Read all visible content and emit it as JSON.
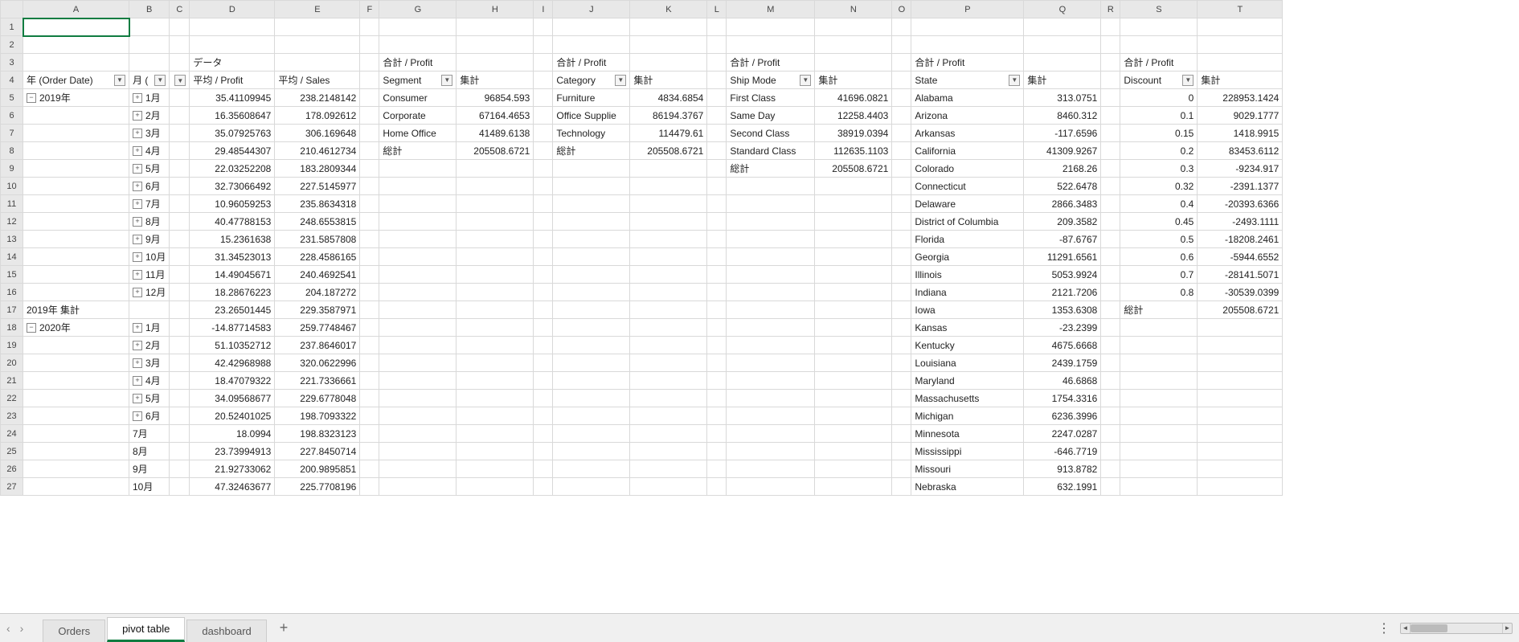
{
  "columns": [
    "A",
    "B",
    "C",
    "D",
    "E",
    "F",
    "G",
    "H",
    "I",
    "J",
    "K",
    "L",
    "M",
    "N",
    "O",
    "P",
    "Q",
    "R",
    "S",
    "T"
  ],
  "col_widths": {
    "A": 132,
    "B": 42,
    "C": 24,
    "D": 106,
    "E": 106,
    "F": 24,
    "G": 96,
    "H": 96,
    "I": 24,
    "J": 96,
    "K": 96,
    "L": 24,
    "M": 110,
    "N": 96,
    "O": 24,
    "P": 140,
    "Q": 96,
    "R": 24,
    "S": 96,
    "T": 106
  },
  "row_count": 27,
  "active_cell": "A1",
  "pivot_year": {
    "header_data": "データ",
    "field_year": "年 (Order Date)",
    "field_month": "月 (Order Date)",
    "col1": "平均 / Profit",
    "col2": "平均 / Sales",
    "subtotal_2019_label": "2019年 集計",
    "rows": [
      {
        "year": "2019年",
        "month": "1月",
        "profit": "35.41109945",
        "sales": "238.2148142",
        "exp": "plus",
        "year_exp": "minus"
      },
      {
        "year": "",
        "month": "2月",
        "profit": "16.35608647",
        "sales": "178.092612",
        "exp": "plus"
      },
      {
        "year": "",
        "month": "3月",
        "profit": "35.07925763",
        "sales": "306.169648",
        "exp": "plus"
      },
      {
        "year": "",
        "month": "4月",
        "profit": "29.48544307",
        "sales": "210.4612734",
        "exp": "plus"
      },
      {
        "year": "",
        "month": "5月",
        "profit": "22.03252208",
        "sales": "183.2809344",
        "exp": "plus"
      },
      {
        "year": "",
        "month": "6月",
        "profit": "32.73066492",
        "sales": "227.5145977",
        "exp": "plus"
      },
      {
        "year": "",
        "month": "7月",
        "profit": "10.96059253",
        "sales": "235.8634318",
        "exp": "plus"
      },
      {
        "year": "",
        "month": "8月",
        "profit": "40.47788153",
        "sales": "248.6553815",
        "exp": "plus"
      },
      {
        "year": "",
        "month": "9月",
        "profit": "15.2361638",
        "sales": "231.5857808",
        "exp": "plus"
      },
      {
        "year": "",
        "month": "10月",
        "profit": "31.34523013",
        "sales": "228.4586165",
        "exp": "plus"
      },
      {
        "year": "",
        "month": "11月",
        "profit": "14.49045671",
        "sales": "240.4692541",
        "exp": "plus"
      },
      {
        "year": "",
        "month": "12月",
        "profit": "18.28676223",
        "sales": "204.187272",
        "exp": "plus"
      },
      {
        "subtotal": true,
        "label": "2019年 集計",
        "profit": "23.26501445",
        "sales": "229.3587971"
      },
      {
        "year": "2020年",
        "month": "1月",
        "profit": "-14.87714583",
        "sales": "259.7748467",
        "exp": "plus",
        "year_exp": "minus"
      },
      {
        "year": "",
        "month": "2月",
        "profit": "51.10352712",
        "sales": "237.8646017",
        "exp": "plus"
      },
      {
        "year": "",
        "month": "3月",
        "profit": "42.42968988",
        "sales": "320.0622996",
        "exp": "plus"
      },
      {
        "year": "",
        "month": "4月",
        "profit": "18.47079322",
        "sales": "221.7336661",
        "exp": "plus"
      },
      {
        "year": "",
        "month": "5月",
        "profit": "34.09568677",
        "sales": "229.6778048",
        "exp": "plus"
      },
      {
        "year": "",
        "month": "6月",
        "profit": "20.52401025",
        "sales": "198.7093322",
        "exp": "plus"
      },
      {
        "year": "",
        "month": "7月",
        "profit": "18.0994",
        "sales": "198.8323123",
        "exp": ""
      },
      {
        "year": "",
        "month": "8月",
        "profit": "23.73994913",
        "sales": "227.8450714",
        "exp": ""
      },
      {
        "year": "",
        "month": "9月",
        "profit": "21.92733062",
        "sales": "200.9895851",
        "exp": ""
      },
      {
        "year": "",
        "month": "10月",
        "profit": "47.32463677",
        "sales": "225.7708196",
        "exp": ""
      }
    ]
  },
  "pivot_segment": {
    "title": "合計 / Profit",
    "field": "Segment",
    "agg": "集計",
    "rows": [
      {
        "k": "Consumer",
        "v": "96854.593"
      },
      {
        "k": "Corporate",
        "v": "67164.4653"
      },
      {
        "k": "Home Office",
        "v": "41489.6138"
      }
    ],
    "total_label": "総計",
    "total": "205508.6721"
  },
  "pivot_category": {
    "title": "合計 / Profit",
    "field": "Category",
    "agg": "集計",
    "rows": [
      {
        "k": "Furniture",
        "v": "4834.6854"
      },
      {
        "k": "Office Supplie",
        "v": "86194.3767"
      },
      {
        "k": "Technology",
        "v": "114479.61"
      }
    ],
    "total_label": "総計",
    "total": "205508.6721"
  },
  "pivot_shipmode": {
    "title": "合計 / Profit",
    "field": "Ship Mode",
    "agg": "集計",
    "rows": [
      {
        "k": "First Class",
        "v": "41696.0821"
      },
      {
        "k": "Same Day",
        "v": "12258.4403"
      },
      {
        "k": "Second Class",
        "v": "38919.0394"
      },
      {
        "k": "Standard Class",
        "v": "112635.1103"
      }
    ],
    "total_label": "総計",
    "total": "205508.6721"
  },
  "pivot_state": {
    "title": "合計 / Profit",
    "field": "State",
    "agg": "集計",
    "rows": [
      {
        "k": "Alabama",
        "v": "313.0751"
      },
      {
        "k": "Arizona",
        "v": "8460.312"
      },
      {
        "k": "Arkansas",
        "v": "-117.6596"
      },
      {
        "k": "California",
        "v": "41309.9267"
      },
      {
        "k": "Colorado",
        "v": "2168.26"
      },
      {
        "k": "Connecticut",
        "v": "522.6478"
      },
      {
        "k": "Delaware",
        "v": "2866.3483"
      },
      {
        "k": "District of Columbia",
        "v": "209.3582"
      },
      {
        "k": "Florida",
        "v": "-87.6767"
      },
      {
        "k": "Georgia",
        "v": "11291.6561"
      },
      {
        "k": "Illinois",
        "v": "5053.9924"
      },
      {
        "k": "Indiana",
        "v": "2121.7206"
      },
      {
        "k": "Iowa",
        "v": "1353.6308"
      },
      {
        "k": "Kansas",
        "v": "-23.2399"
      },
      {
        "k": "Kentucky",
        "v": "4675.6668"
      },
      {
        "k": "Louisiana",
        "v": "2439.1759"
      },
      {
        "k": "Maryland",
        "v": "46.6868"
      },
      {
        "k": "Massachusetts",
        "v": "1754.3316"
      },
      {
        "k": "Michigan",
        "v": "6236.3996"
      },
      {
        "k": "Minnesota",
        "v": "2247.0287"
      },
      {
        "k": "Mississippi",
        "v": "-646.7719"
      },
      {
        "k": "Missouri",
        "v": "913.8782"
      },
      {
        "k": "Nebraska",
        "v": "632.1991"
      }
    ]
  },
  "pivot_discount": {
    "title": "合計 / Profit",
    "field": "Discount",
    "agg": "集計",
    "rows": [
      {
        "k": "0",
        "v": "228953.1424"
      },
      {
        "k": "0.1",
        "v": "9029.1777"
      },
      {
        "k": "0.15",
        "v": "1418.9915"
      },
      {
        "k": "0.2",
        "v": "83453.6112"
      },
      {
        "k": "0.3",
        "v": "-9234.917"
      },
      {
        "k": "0.32",
        "v": "-2391.1377"
      },
      {
        "k": "0.4",
        "v": "-20393.6366"
      },
      {
        "k": "0.45",
        "v": "-2493.1111"
      },
      {
        "k": "0.5",
        "v": "-18208.2461"
      },
      {
        "k": "0.6",
        "v": "-5944.6552"
      },
      {
        "k": "0.7",
        "v": "-28141.5071"
      },
      {
        "k": "0.8",
        "v": "-30539.0399"
      }
    ],
    "total_label": "総計",
    "total": "205508.6721"
  },
  "tabs": {
    "items": [
      "Orders",
      "pivot table",
      "dashboard"
    ],
    "active": 1
  }
}
